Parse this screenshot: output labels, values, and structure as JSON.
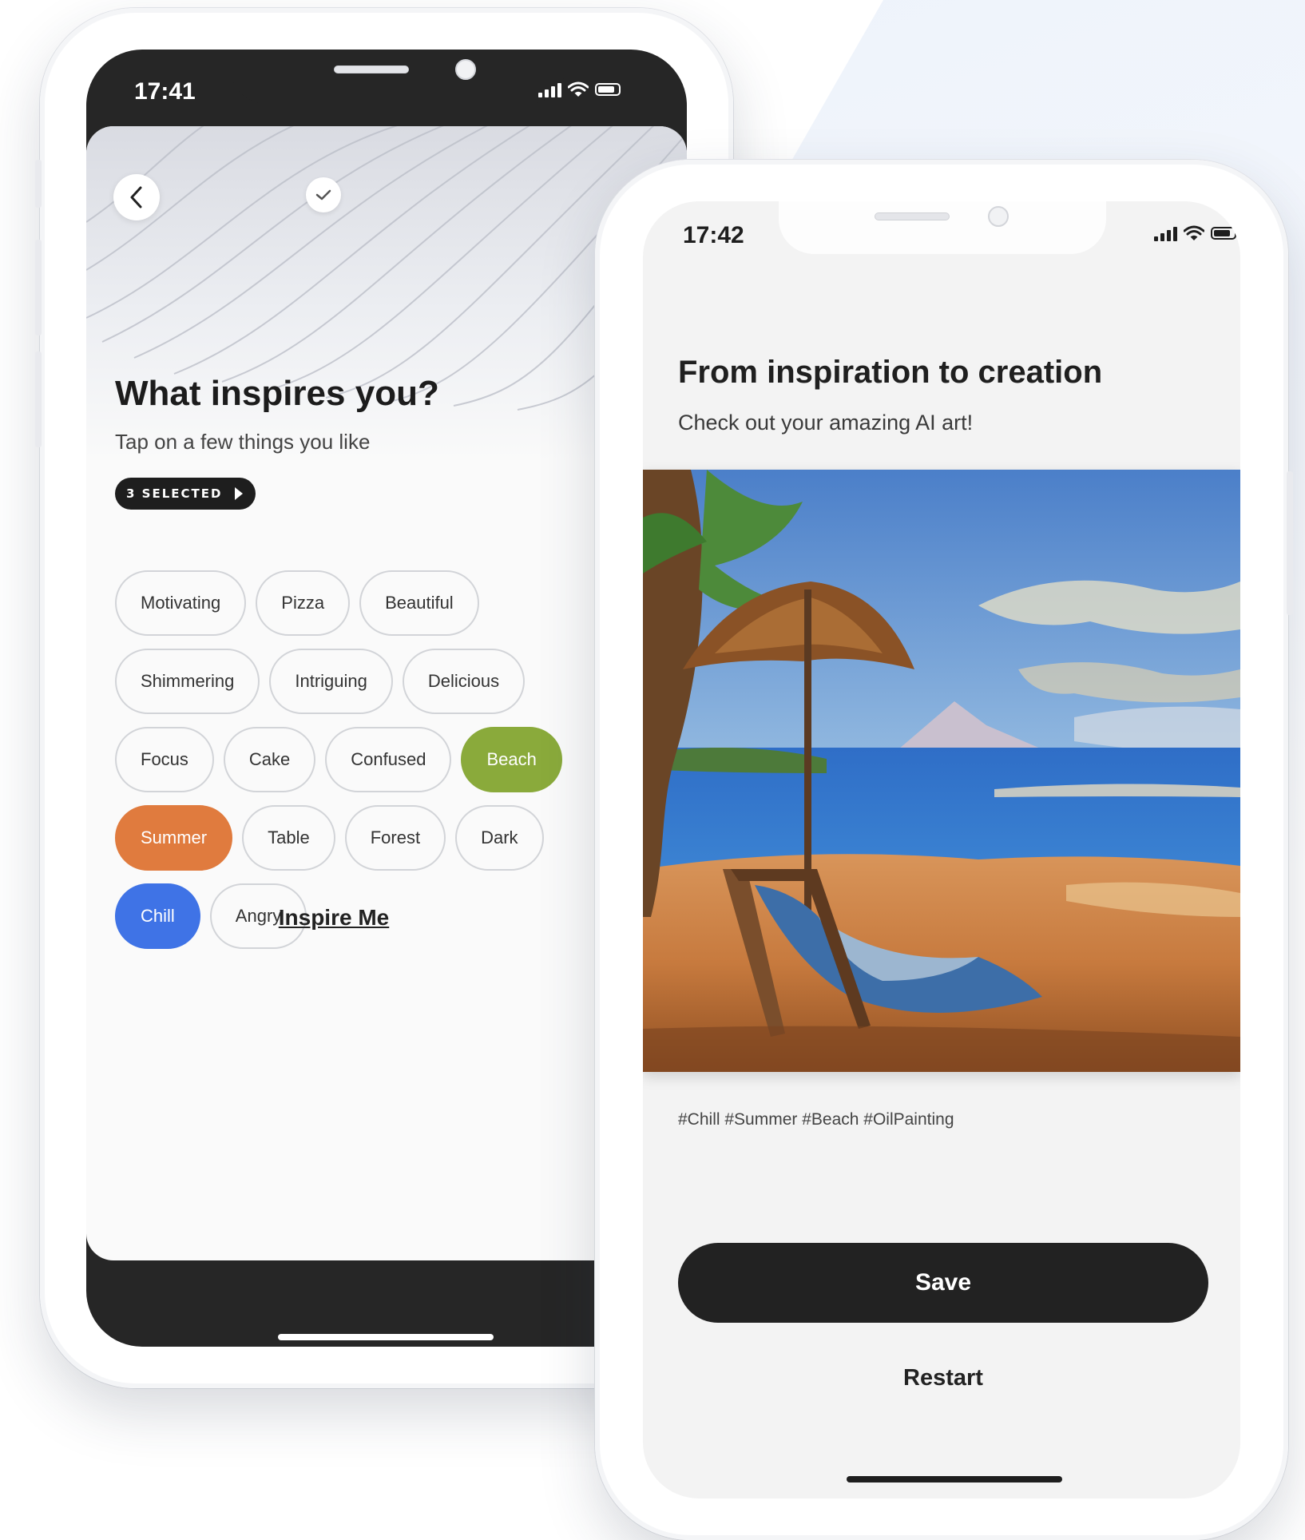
{
  "left_phone": {
    "status_time": "17:41",
    "title": "What inspires you?",
    "subtitle": "Tap on a few things you like",
    "selected_badge": "3 SELECTED",
    "chip_rows": [
      [
        {
          "label": "Motivating"
        },
        {
          "label": "Pizza"
        },
        {
          "label": "Beautiful"
        }
      ],
      [
        {
          "label": "Shimmering"
        },
        {
          "label": "Intriguing"
        },
        {
          "label": "Delicious"
        }
      ],
      [
        {
          "label": "Focus"
        },
        {
          "label": "Cake"
        },
        {
          "label": "Confused"
        },
        {
          "label": "Beach",
          "selected": true,
          "color": "#8aaa3b"
        }
      ],
      [
        {
          "label": "Summer",
          "selected": true,
          "color": "#e07b3e"
        },
        {
          "label": "Table"
        },
        {
          "label": "Forest"
        },
        {
          "label": "Dark"
        }
      ],
      [
        {
          "label": "Chill",
          "selected": true,
          "color": "#3f73e6"
        },
        {
          "label": "Angry"
        }
      ]
    ],
    "inspire_link": "Inspire Me"
  },
  "right_phone": {
    "status_time": "17:42",
    "title": "From inspiration to creation",
    "subtitle": "Check out your amazing AI art!",
    "hashtags": "#Chill #Summer #Beach #OilPainting",
    "save_label": "Save",
    "restart_label": "Restart"
  },
  "icons": {
    "back": "chevron-left-icon",
    "check": "check-icon",
    "signal": "signal-icon",
    "wifi": "wifi-icon",
    "battery": "battery-icon",
    "badge_arrow": "caret-right-icon"
  },
  "colors": {
    "accent_dark": "#222222",
    "beach": "#8aaa3b",
    "summer": "#e07b3e",
    "chill": "#3f73e6"
  }
}
